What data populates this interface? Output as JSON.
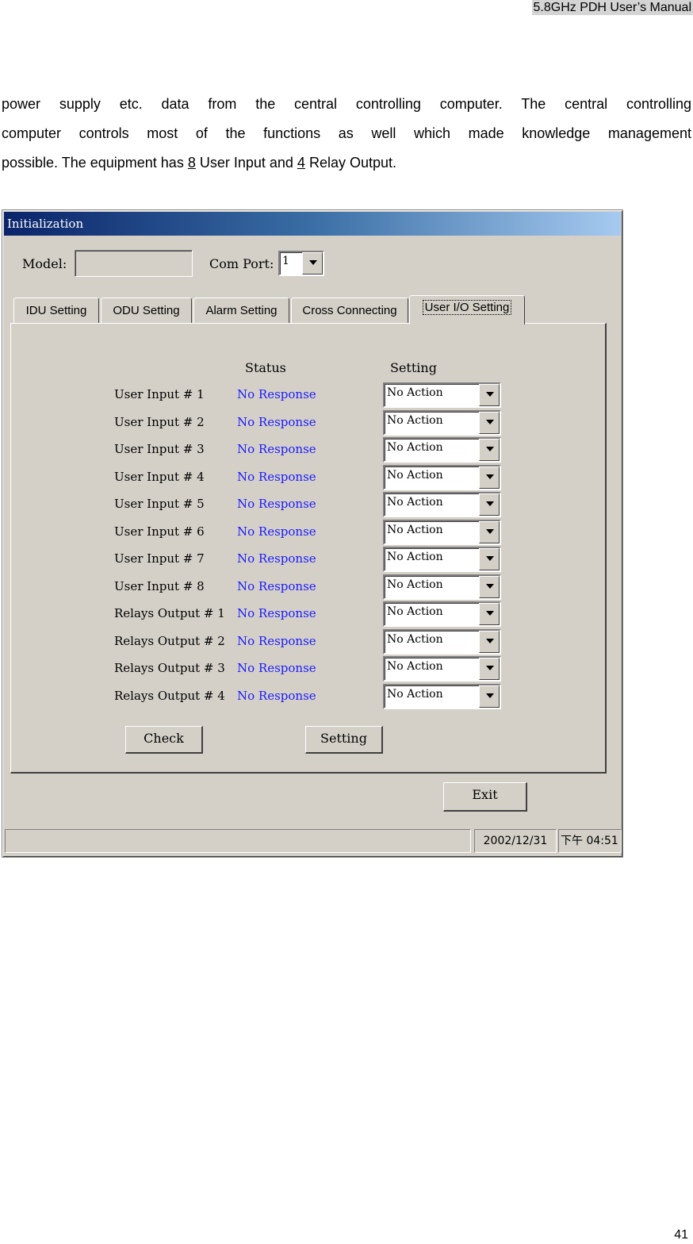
{
  "document": {
    "header": "5.8GHz PDH User’s Manual",
    "paragraph_lines": [
      "power supply etc. data from the central controlling computer. The central controlling",
      "computer controls most of the functions as well which made knowledge management"
    ],
    "paragraph_last_prefix": "possible. The equipment has ",
    "user_input_count": "8",
    "paragraph_mid": " User Input and ",
    "relay_output_count": "4",
    "paragraph_suffix": " Relay Output.",
    "page_number": "41"
  },
  "window": {
    "title": "Initialization",
    "model_label": "Model:",
    "model_value": "",
    "comport_label": "Com Port:",
    "comport_value": "1",
    "tabs": [
      {
        "label": "IDU Setting"
      },
      {
        "label": "ODU Setting"
      },
      {
        "label": "Alarm Setting"
      },
      {
        "label": "Cross Connecting"
      },
      {
        "label": "User I/O Setting"
      }
    ],
    "active_tab": "User I/O Setting",
    "panel": {
      "status_header": "Status",
      "setting_header": "Setting",
      "rows": [
        {
          "label": "User Input # 1",
          "status": "No Response",
          "setting": "No Action"
        },
        {
          "label": "User Input # 2",
          "status": "No Response",
          "setting": "No Action"
        },
        {
          "label": "User Input # 3",
          "status": "No Response",
          "setting": "No Action"
        },
        {
          "label": "User Input # 4",
          "status": "No Response",
          "setting": "No Action"
        },
        {
          "label": "User Input # 5",
          "status": "No Response",
          "setting": "No Action"
        },
        {
          "label": "User Input # 6",
          "status": "No Response",
          "setting": "No Action"
        },
        {
          "label": "User Input # 7",
          "status": "No Response",
          "setting": "No Action"
        },
        {
          "label": "User Input # 8",
          "status": "No Response",
          "setting": "No Action"
        },
        {
          "label": "Relays Output # 1",
          "status": "No Response",
          "setting": "No Action"
        },
        {
          "label": "Relays Output # 2",
          "status": "No Response",
          "setting": "No Action"
        },
        {
          "label": "Relays Output # 3",
          "status": "No Response",
          "setting": "No Action"
        },
        {
          "label": "Relays Output # 4",
          "status": "No Response",
          "setting": "No Action"
        }
      ],
      "check_button": "Check",
      "setting_button": "Setting"
    },
    "exit_button": "Exit",
    "statusbar": {
      "message": "",
      "date": "2002/12/31",
      "time": "下午 04:51"
    },
    "colors": {
      "status_text": "#1a1aff",
      "title_gradient_start": "#0a246a",
      "title_gradient_end": "#a6caf0",
      "face": "#d4d0c8"
    }
  }
}
